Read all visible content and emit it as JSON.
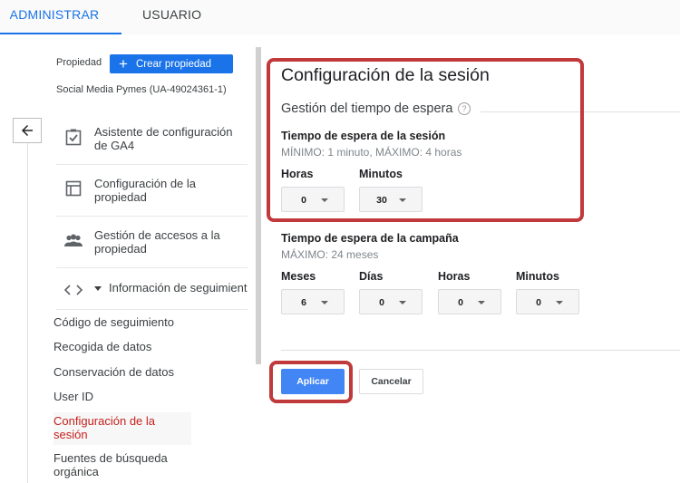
{
  "tabs": {
    "admin": "ADMINISTRAR",
    "user": "USUARIO"
  },
  "property": {
    "label": "Propiedad",
    "create_button": "Crear propiedad",
    "name": "Social Media Pymes (UA-49024361-1)"
  },
  "sidebar": {
    "items": [
      {
        "label": "Asistente de configuración de GA4",
        "icon": "checklist-icon"
      },
      {
        "label": "Configuración de la propiedad",
        "icon": "property-settings-icon"
      },
      {
        "label": "Gestión de accesos a la propiedad",
        "icon": "people-icon"
      },
      {
        "label": "Información de seguimiento",
        "icon": "code-icon"
      }
    ],
    "subitems": [
      "Código de seguimiento",
      "Recogida de datos",
      "Conservación de datos",
      "User ID",
      "Configuración de la sesión",
      "Fuentes de búsqueda orgánica"
    ],
    "active_subitem": "Configuración de la sesión"
  },
  "main": {
    "title": "Configuración de la sesión",
    "section_title": "Gestión del tiempo de espera",
    "session_timeout": {
      "title": "Tiempo de espera de la sesión",
      "hint": "MÍNIMO: 1 minuto, MÁXIMO: 4 horas",
      "hours_label": "Horas",
      "hours_value": "0",
      "minutes_label": "Minutos",
      "minutes_value": "30"
    },
    "campaign_timeout": {
      "title": "Tiempo de espera de la campaña",
      "hint": "MÁXIMO: 24 meses",
      "months_label": "Meses",
      "months_value": "6",
      "days_label": "Días",
      "days_value": "0",
      "hours_label": "Horas",
      "hours_value": "0",
      "minutes_label": "Minutos",
      "minutes_value": "0"
    },
    "apply_button": "Aplicar",
    "cancel_button": "Cancelar"
  },
  "colors": {
    "accent": "#1a73e8",
    "apply_button": "#4285f4",
    "highlight": "#c0393b",
    "active_nav": "#c5221f"
  }
}
